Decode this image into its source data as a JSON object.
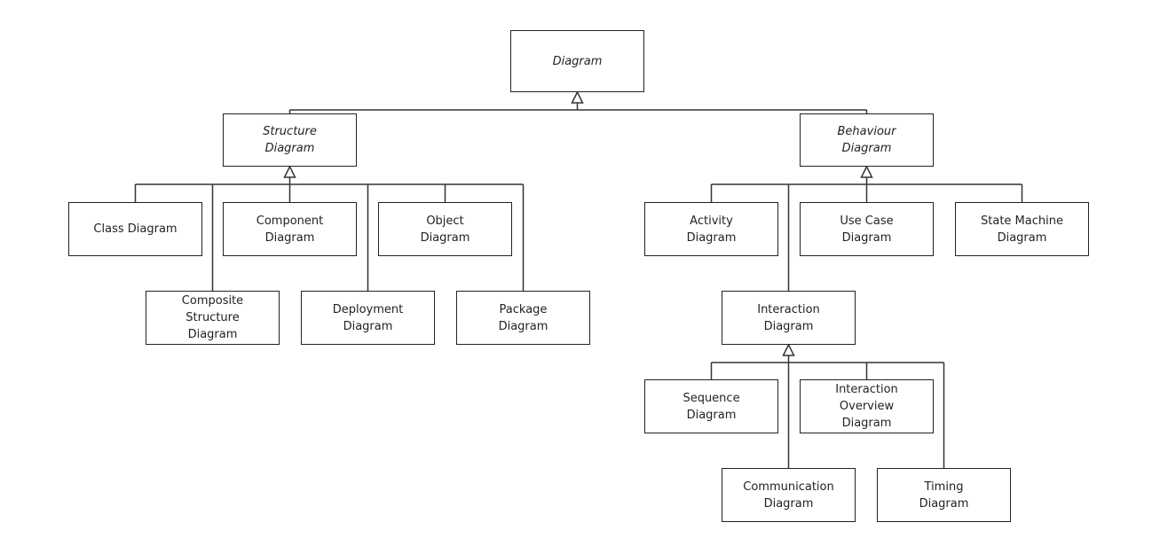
{
  "nodes": {
    "diagram": {
      "label": "Diagram",
      "abstract": true
    },
    "structure": {
      "label": "Structure\nDiagram",
      "abstract": true
    },
    "behaviour": {
      "label": "Behaviour\nDiagram",
      "abstract": true
    },
    "class": {
      "label": "Class Diagram"
    },
    "component": {
      "label": "Component\nDiagram"
    },
    "object": {
      "label": "Object\nDiagram"
    },
    "composite": {
      "label": "Composite\nStructure\nDiagram"
    },
    "deployment": {
      "label": "Deployment\nDiagram"
    },
    "package": {
      "label": "Package\nDiagram"
    },
    "activity": {
      "label": "Activity\nDiagram"
    },
    "usecase": {
      "label": "Use Case\nDiagram"
    },
    "statemachine": {
      "label": "State Machine\nDiagram"
    },
    "interaction": {
      "label": "Interaction\nDiagram"
    },
    "sequence": {
      "label": "Sequence\nDiagram"
    },
    "overview": {
      "label": "Interaction\nOverview\nDiagram"
    },
    "communication": {
      "label": "Communication\nDiagram"
    },
    "timing": {
      "label": "Timing\nDiagram"
    }
  },
  "generalizations": [
    {
      "parent": "diagram",
      "children": [
        "structure",
        "behaviour"
      ]
    },
    {
      "parent": "structure",
      "children": [
        "class",
        "component",
        "object",
        "composite",
        "deployment",
        "package"
      ]
    },
    {
      "parent": "behaviour",
      "children": [
        "activity",
        "usecase",
        "statemachine",
        "interaction"
      ]
    },
    {
      "parent": "interaction",
      "children": [
        "sequence",
        "overview",
        "communication",
        "timing"
      ]
    }
  ]
}
